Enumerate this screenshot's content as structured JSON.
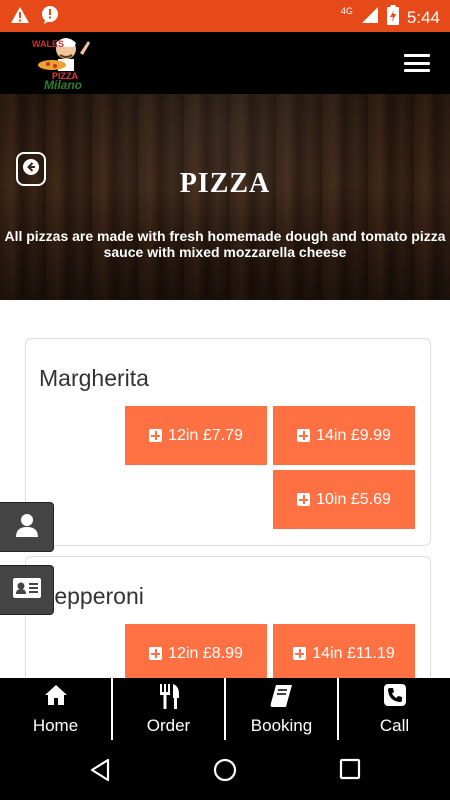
{
  "status_bar": {
    "time": "5:44",
    "network": "4G"
  },
  "header": {
    "logo_text_top": "WALES",
    "logo_text_mid": "PIZZA",
    "logo_text_bottom": "Milano"
  },
  "hero": {
    "title": "PIZZA",
    "description": "All pizzas are made with fresh homemade dough and tomato pizza sauce with mixed mozzarella cheese"
  },
  "items": [
    {
      "name": "Margherita",
      "prices": [
        "12in £7.79",
        "14in £9.99",
        "10in £5.69"
      ]
    },
    {
      "name": "Pepperoni",
      "prices": [
        "12in £8.99",
        "14in £11.19"
      ]
    }
  ],
  "bottom_nav": [
    {
      "label": "Home",
      "icon": "home-icon"
    },
    {
      "label": "Order",
      "icon": "cutlery-icon"
    },
    {
      "label": "Booking",
      "icon": "book-icon"
    },
    {
      "label": "Call",
      "icon": "phone-icon"
    }
  ],
  "colors": {
    "status": "#e64a19",
    "accent": "#ff7043",
    "header": "#000000"
  }
}
